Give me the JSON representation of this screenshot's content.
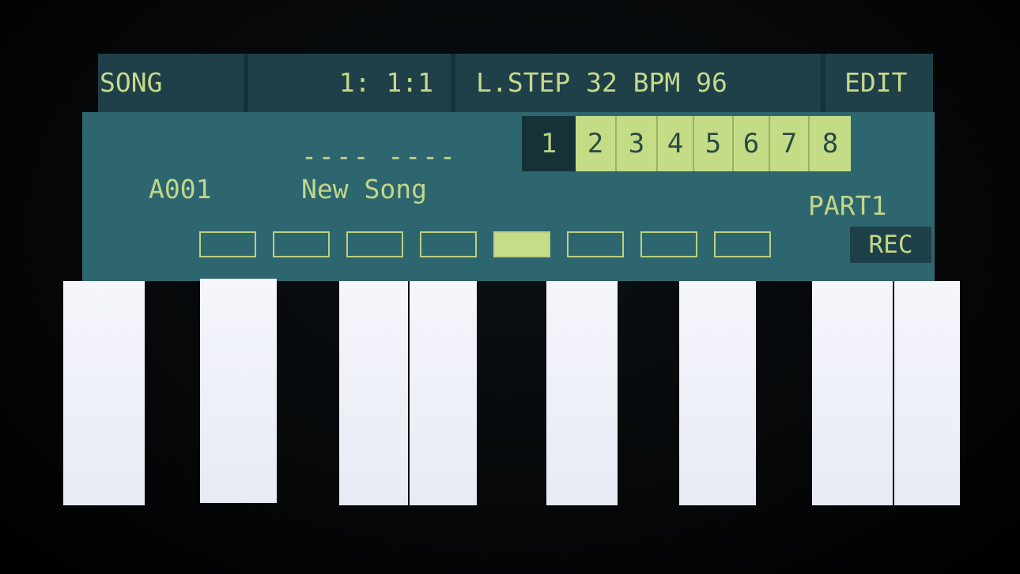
{
  "topbar": {
    "mode_label": "SONG",
    "position": "1: 1:1",
    "step_tempo": "L.STEP 32 BPM 96",
    "edit_label": "EDIT"
  },
  "song": {
    "slot_id": "A001",
    "name_dashes": "---- ----",
    "name": "New Song",
    "part_label": "PART1",
    "rec_label": "REC"
  },
  "parts": [
    "1",
    "2",
    "3",
    "4",
    "5",
    "6",
    "7",
    "8"
  ],
  "active_part": "1",
  "slots_filled": [
    false,
    false,
    false,
    false,
    true,
    false,
    false,
    false
  ],
  "colors": {
    "lcd_text": "#c7d98a",
    "panel": "#2e6670",
    "topbar": "#1f4048",
    "key_white": "#f0f3f9"
  }
}
